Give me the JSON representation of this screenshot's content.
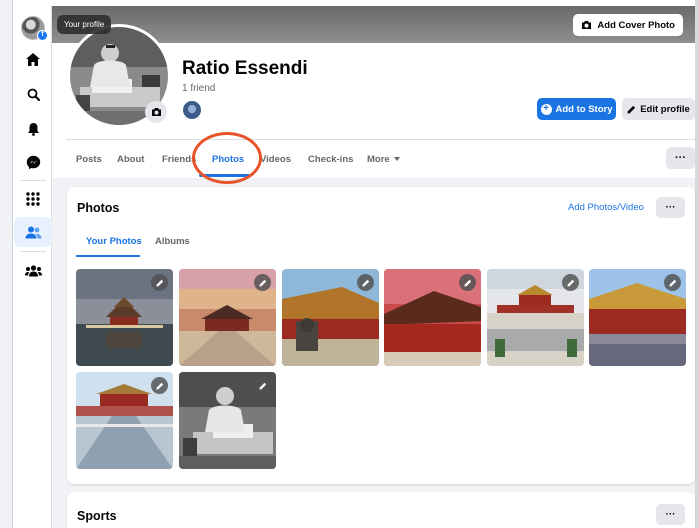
{
  "tooltip": "Your profile",
  "cover": {
    "add_cover_label": "Add Cover Photo"
  },
  "profile": {
    "name": "Ratio Essendi",
    "friends_count": "1 friend",
    "add_story_label": "Add to Story",
    "edit_profile_label": "Edit profile"
  },
  "tabs": [
    {
      "label": "Posts"
    },
    {
      "label": "About"
    },
    {
      "label": "Friends"
    },
    {
      "label": "Photos",
      "active": true
    },
    {
      "label": "Videos"
    },
    {
      "label": "Check-ins"
    },
    {
      "label": "More"
    }
  ],
  "tabs_more_button": "···",
  "photos_card": {
    "title": "Photos",
    "add_link": "Add Photos/Video",
    "more_button": "···",
    "subtabs": [
      {
        "label": "Your Photos",
        "active": true
      },
      {
        "label": "Albums"
      }
    ],
    "photos": [
      {
        "subject": "corner-tower-moat"
      },
      {
        "subject": "palace-sunset-courtyard"
      },
      {
        "subject": "hall-lion-statue"
      },
      {
        "subject": "hall-red-sky"
      },
      {
        "subject": "plaza-crowd"
      },
      {
        "subject": "gate-crowd"
      },
      {
        "subject": "bridge-courtyard"
      },
      {
        "subject": "man-writing-bw"
      }
    ]
  },
  "sports_card": {
    "title": "Sports",
    "more_button": "···"
  },
  "colors": {
    "accent": "#1b74e4",
    "highlight_circle": "#e8542a",
    "page_bg": "#f0f2f5"
  }
}
